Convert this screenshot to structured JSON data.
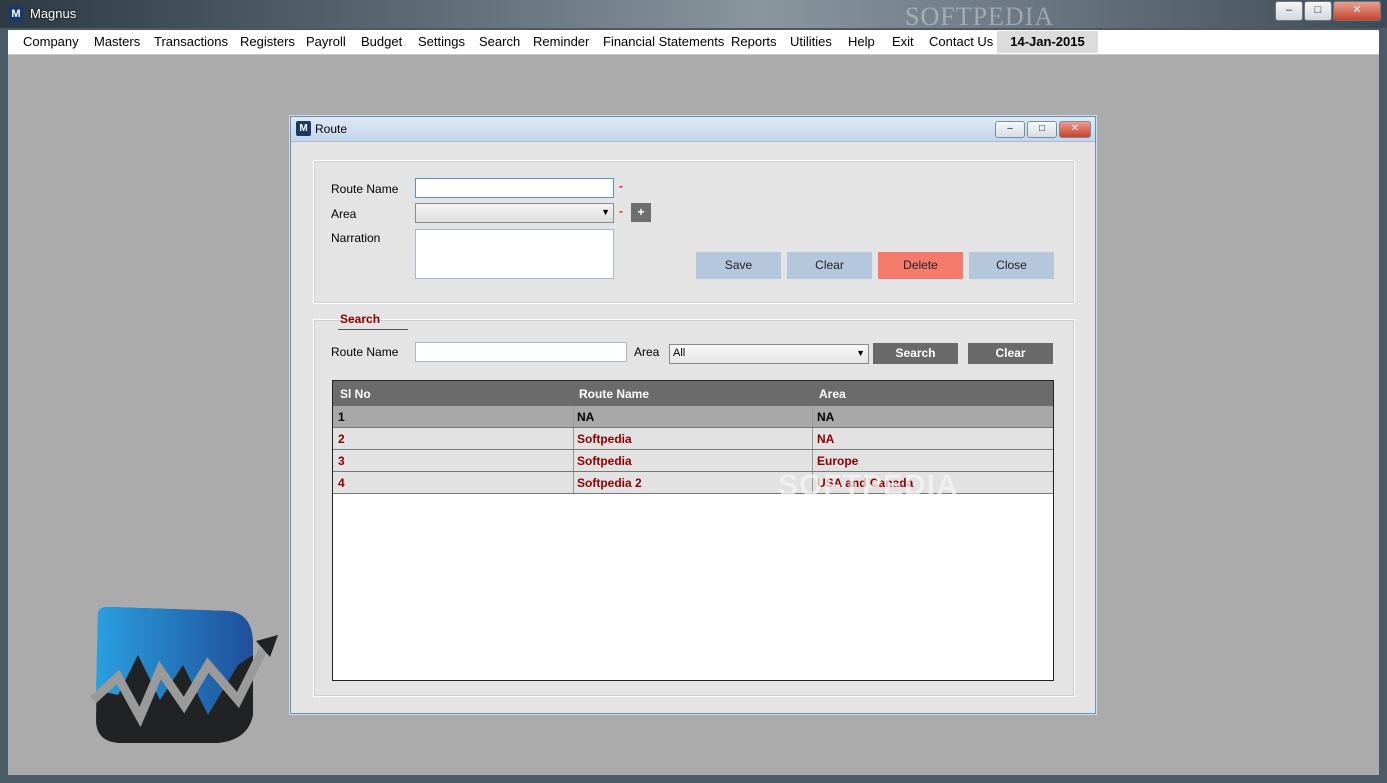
{
  "app": {
    "title": "Magnus",
    "icon_letter": "M",
    "watermark": "SOFTPEDIA"
  },
  "window_controls": {
    "minimize": "–",
    "maximize": "□",
    "close": "✕"
  },
  "menu": {
    "items": [
      "Company",
      "Masters",
      "Transactions",
      "Registers",
      "Payroll",
      "Budget",
      "Settings",
      "Search",
      "Reminder",
      "Financial Statements",
      "Reports",
      "Utilities",
      "Help",
      "Exit",
      "Contact Us"
    ],
    "date": "14-Jan-2015"
  },
  "dialog": {
    "title": "Route",
    "form": {
      "route_name_label": "Route Name",
      "route_name_value": "",
      "area_label": "Area",
      "area_value": "",
      "narration_label": "Narration",
      "narration_value": "",
      "required_mark": "-",
      "add_area_label": "+"
    },
    "actions": {
      "save": "Save",
      "clear": "Clear",
      "delete": "Delete",
      "close": "Close"
    },
    "search": {
      "legend": "Search",
      "route_name_label": "Route Name",
      "route_name_value": "",
      "area_label": "Area",
      "area_value": "All",
      "search_button": "Search",
      "clear_button": "Clear"
    },
    "grid": {
      "columns": [
        "Sl No",
        "Route Name",
        "Area"
      ],
      "rows": [
        [
          "1",
          "NA",
          "NA"
        ],
        [
          "2",
          "Softpedia",
          "NA"
        ],
        [
          "3",
          "Softpedia",
          "Europe"
        ],
        [
          "4",
          "Softpedia 2",
          "USA and Canada"
        ]
      ],
      "watermark": "SOFTPEDIA"
    }
  },
  "colors": {
    "delete_button": "#f47a6c",
    "action_button": "#b5c7dc",
    "grid_text": "#8b0000",
    "workspace": "#ababab"
  }
}
